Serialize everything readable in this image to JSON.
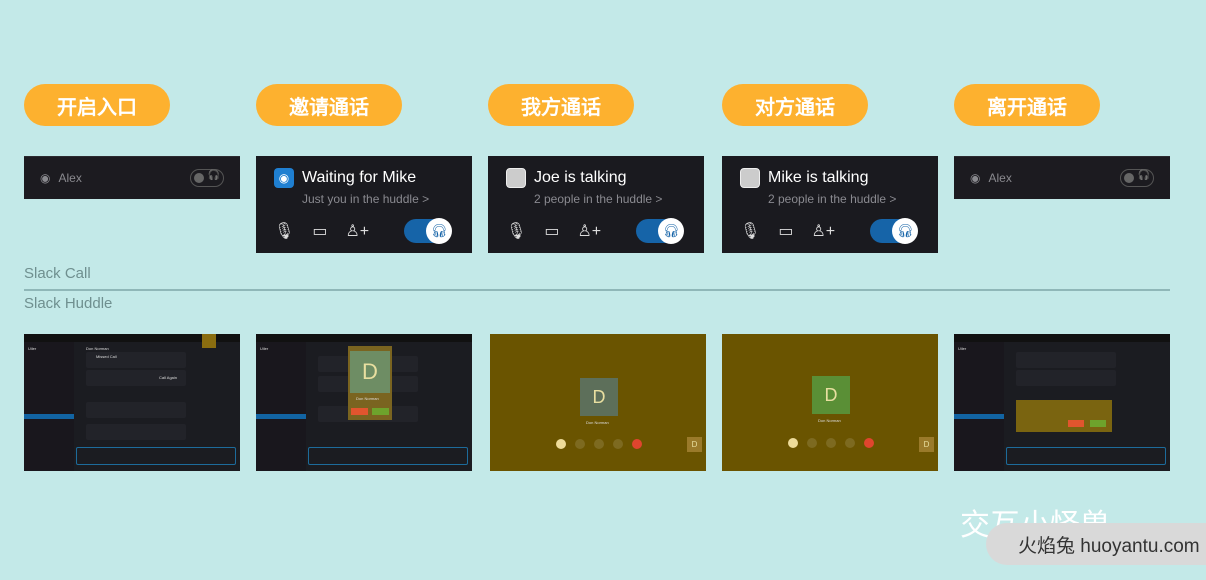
{
  "steps": [
    "开启入口",
    "邀请通话",
    "我方通话",
    "对方通话",
    "离开通话"
  ],
  "mini": {
    "name": "Alex",
    "icon": "huddle-broadcast-icon",
    "toggle_icon": "headphones-icon"
  },
  "cards": [
    {
      "title": "Waiting for Mike",
      "sub": "Just you in the huddle >",
      "avatar": "huddle-broadcast-icon"
    },
    {
      "title": "Joe is talking",
      "sub": "2 people in the huddle >",
      "avatar": "joe-photo"
    },
    {
      "title": "Mike is talking",
      "sub": "2 people in the huddle >",
      "avatar": "mike-photo"
    }
  ],
  "controls": {
    "mic": "🎙",
    "screen": "🖥",
    "add": "👤+",
    "headphones": "🎧"
  },
  "labels": {
    "call": "Slack Call",
    "huddle": "Slack Huddle"
  },
  "thumbs": {
    "contact": "Don Norman",
    "initial": "D",
    "workspace": "Uiler",
    "missed": "Missed Call",
    "call_again": "Call Again",
    "decline": "Decline",
    "join": "Join"
  },
  "colors": {
    "accent": "#fdb12f",
    "background": "#c3e9e8",
    "toggle": "#1664a8"
  },
  "watermark": {
    "brand": "交互小怪兽",
    "site": "火焰兔 huoyantu.com"
  }
}
